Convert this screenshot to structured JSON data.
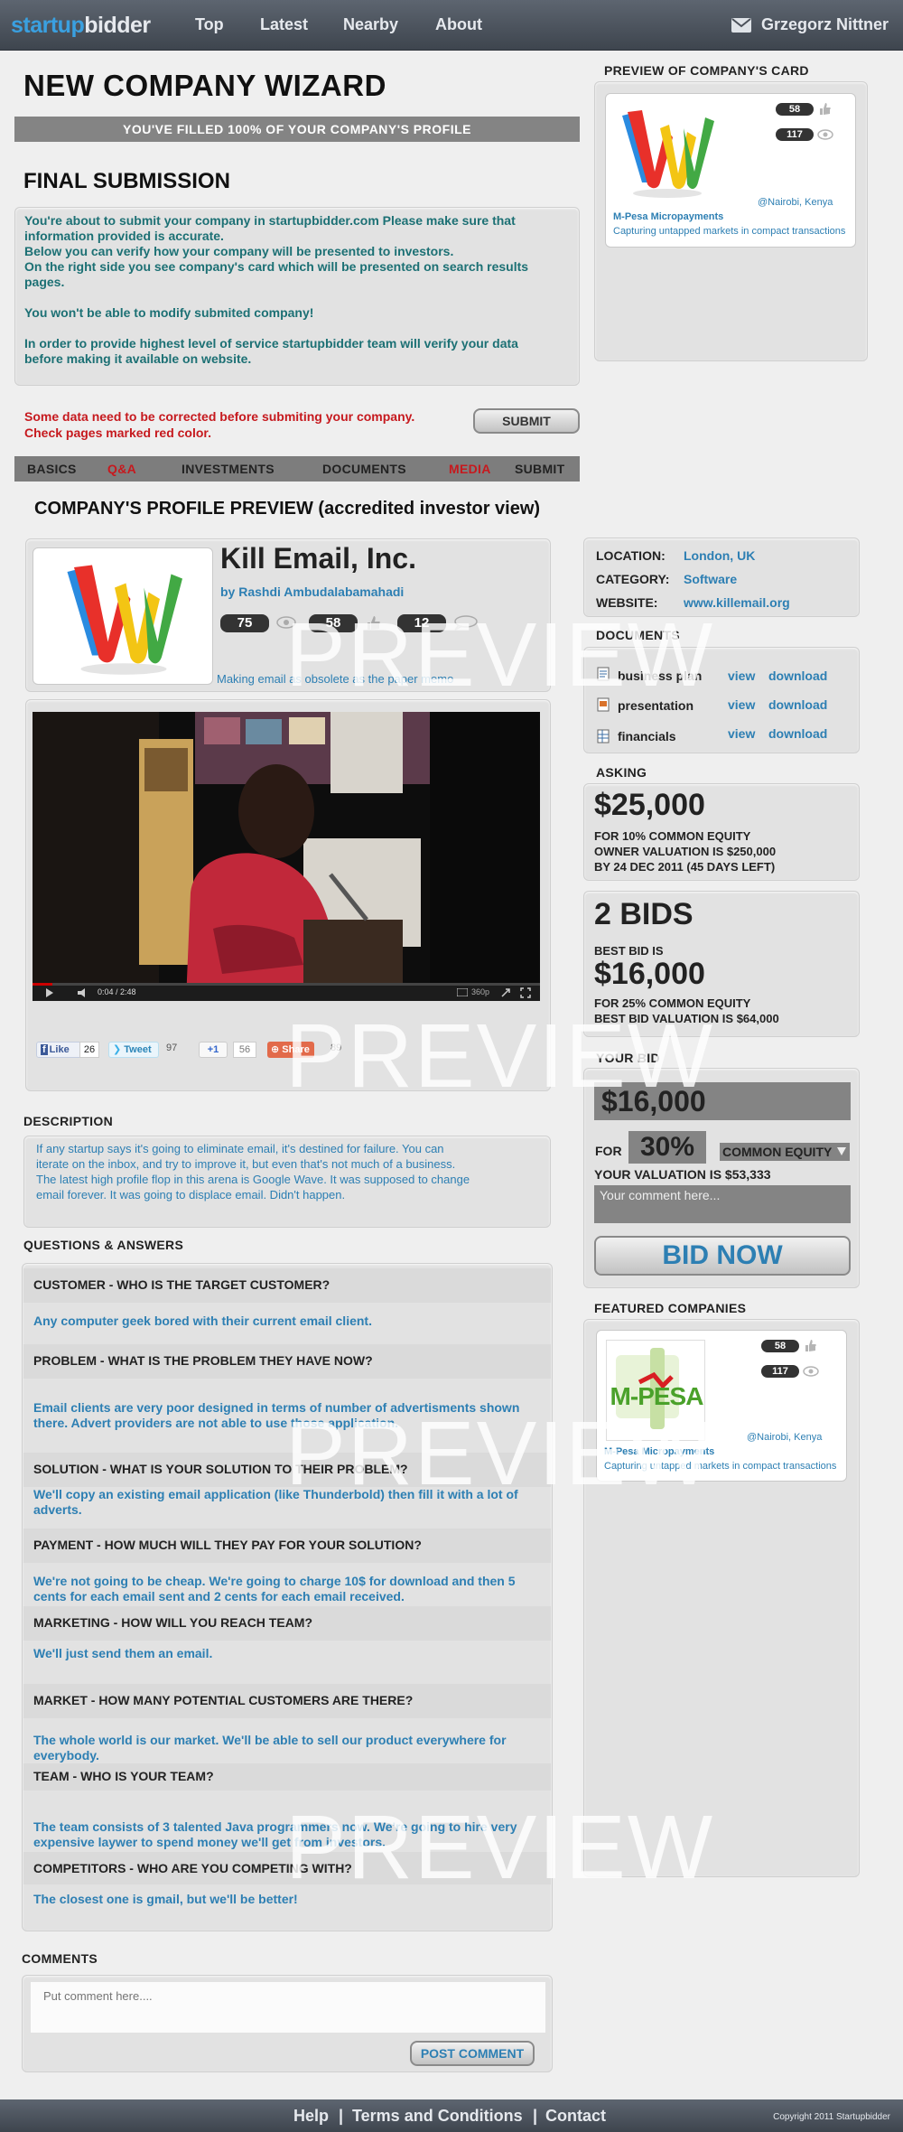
{
  "nav": {
    "logo_a": "startup",
    "logo_b": "bidder",
    "items": [
      "Top",
      "Latest",
      "Nearby",
      "About"
    ],
    "user": "Grzegorz Nittner"
  },
  "wizard": {
    "title": "NEW COMPANY WIZARD",
    "progress": "YOU'VE FILLED 100% OF YOUR COMPANY'S PROFILE",
    "progress_value": 1.0,
    "final_title": "FINAL SUBMISSION",
    "info_lines": [
      "You're about to submit your company in startupbidder.com Please make sure that",
      "information provided is accurate.",
      "Below you can verify how your company will be presented to investors.",
      "On the right side you see company's card which will be presented on search results",
      "pages.",
      "",
      "You won't be able to modify submited company!",
      "",
      "In order to provide highest level of service startupbidder team will verify your data",
      "before making it available on website."
    ],
    "error_lines": [
      "Some data need to be corrected before submiting your company.",
      "Check pages marked red color."
    ],
    "submit": "SUBMIT",
    "tabs": [
      {
        "label": "BASICS",
        "error": false
      },
      {
        "label": "Q&A",
        "error": true
      },
      {
        "label": "INVESTMENTS",
        "error": false
      },
      {
        "label": "DOCUMENTS",
        "error": false
      },
      {
        "label": "MEDIA",
        "error": true
      },
      {
        "label": "SUBMIT",
        "error": false
      }
    ]
  },
  "card_preview": {
    "heading": "PREVIEW OF COMPANY'S CARD",
    "likes": "58",
    "views": "117",
    "location": "@Nairobi, Kenya",
    "name": "M-Pesa Micropayments",
    "tagline": "Capturing untapped markets in compact transactions"
  },
  "profile": {
    "heading": "COMPANY'S PROFILE PREVIEW (accredited investor view)",
    "name": "Kill Email, Inc.",
    "by": "by Rashdi Ambudalabamahadi",
    "stats": [
      "75",
      "58",
      "12"
    ],
    "tagline": "Making email as obsolete as the paper memo",
    "video": {
      "time": "0:04 / 2:48",
      "quality": "360p",
      "progress": 0.04
    },
    "social": {
      "like": "Like",
      "like_count": "26",
      "tweet": "Tweet",
      "tweet_count": "97",
      "plus": "+1",
      "plus_count": "56",
      "share": "Share",
      "share_count": "89"
    },
    "watermark": "PREVIEW"
  },
  "description": {
    "heading": "DESCRIPTION",
    "lines": [
      "If any startup says it's going to eliminate email, it's destined for failure. You can",
      "iterate on the inbox, and try to improve it, but even that's not much of a business.",
      "The latest high profile flop in this arena is Google Wave. It was supposed to change",
      "email forever. It was going to displace email. Didn't happen."
    ]
  },
  "qa": {
    "heading": "QUESTIONS & ANSWERS",
    "items": [
      {
        "q": "CUSTOMER - WHO IS THE TARGET CUSTOMER?",
        "a": [
          "Any computer geek bored with their current email client."
        ]
      },
      {
        "q": "PROBLEM - WHAT IS THE PROBLEM THEY HAVE NOW?",
        "a": [
          "Email clients are very poor designed in terms of number of advertisments shown",
          "there. Advert providers are not able to use those application."
        ]
      },
      {
        "q": "SOLUTION - WHAT IS YOUR SOLUTION TO THEIR PROBLEM?",
        "a": [
          "We'll copy an existing email application (like Thunderbold) then fill it with a lot of",
          "adverts."
        ]
      },
      {
        "q": "PAYMENT - HOW MUCH WILL THEY PAY FOR YOUR SOLUTION?",
        "a": [
          "We're not going to be cheap. We're going to charge 10$ for download and then 5",
          "cents for each email sent and 2 cents for each email received."
        ]
      },
      {
        "q": "MARKETING - HOW WILL YOU REACH TEAM?",
        "a": [
          "We'll just send them an email."
        ]
      },
      {
        "q": "MARKET - HOW MANY POTENTIAL CUSTOMERS ARE THERE?",
        "a": [
          "The whole world is our market. We'll be able to sell our product everywhere for",
          "everybody."
        ]
      },
      {
        "q": "TEAM - WHO IS YOUR TEAM?",
        "a": [
          "The team consists of 3 talented Java programmers now. We're going to hire very",
          "expensive laywer to spend money we'll get from investors."
        ]
      },
      {
        "q": "COMPETITORS - WHO ARE YOU COMPETING WITH?",
        "a": [
          "The closest one is gmail, but we'll be better!"
        ]
      }
    ]
  },
  "comments": {
    "heading": "COMMENTS",
    "placeholder": "Put comment here....",
    "button": "POST COMMENT"
  },
  "info": {
    "location_label": "LOCATION:",
    "location": "London, UK",
    "category_label": "CATEGORY:",
    "category": "Software",
    "website_label": "WEBSITE:",
    "website": "www.killemail.org"
  },
  "documents": {
    "heading": "DOCUMENTS",
    "items": [
      {
        "name": "business plan",
        "view": "view",
        "download": "download"
      },
      {
        "name": "presentation",
        "view": "view",
        "download": "download"
      },
      {
        "name": "financials",
        "view": "view",
        "download": "download"
      }
    ]
  },
  "asking": {
    "heading": "ASKING",
    "amount": "$25,000",
    "line1": "FOR 10% COMMON EQUITY",
    "line2": "OWNER VALUATION IS $250,000",
    "line3": "BY 24 DEC 2011 (45 DAYS LEFT)"
  },
  "bids": {
    "count": "2 BIDS",
    "best_label": "BEST BID IS",
    "best": "$16,000",
    "line1": "FOR 25% COMMON EQUITY",
    "line2": "BEST BID VALUATION IS $64,000"
  },
  "your_bid": {
    "heading": "YOUR BID",
    "amount": "$16,000",
    "for": "FOR",
    "percent": "30%",
    "equity": "COMMON EQUITY",
    "valuation": "YOUR VALUATION IS $53,333",
    "comment_placeholder": "Your comment here...",
    "button": "BID NOW"
  },
  "featured": {
    "heading": "FEATURED COMPANIES",
    "likes": "58",
    "views": "117",
    "logo_text": "M-PESA",
    "location": "@Nairobi, Kenya",
    "name": "M-Pesa Micropayments",
    "tagline": "Capturing untapped markets in compact transactions"
  },
  "footer": {
    "help": "Help",
    "terms": "Terms and Conditions",
    "contact": "Contact",
    "sep": "|",
    "copyright": "Copyright 2011 Startupbidder"
  }
}
